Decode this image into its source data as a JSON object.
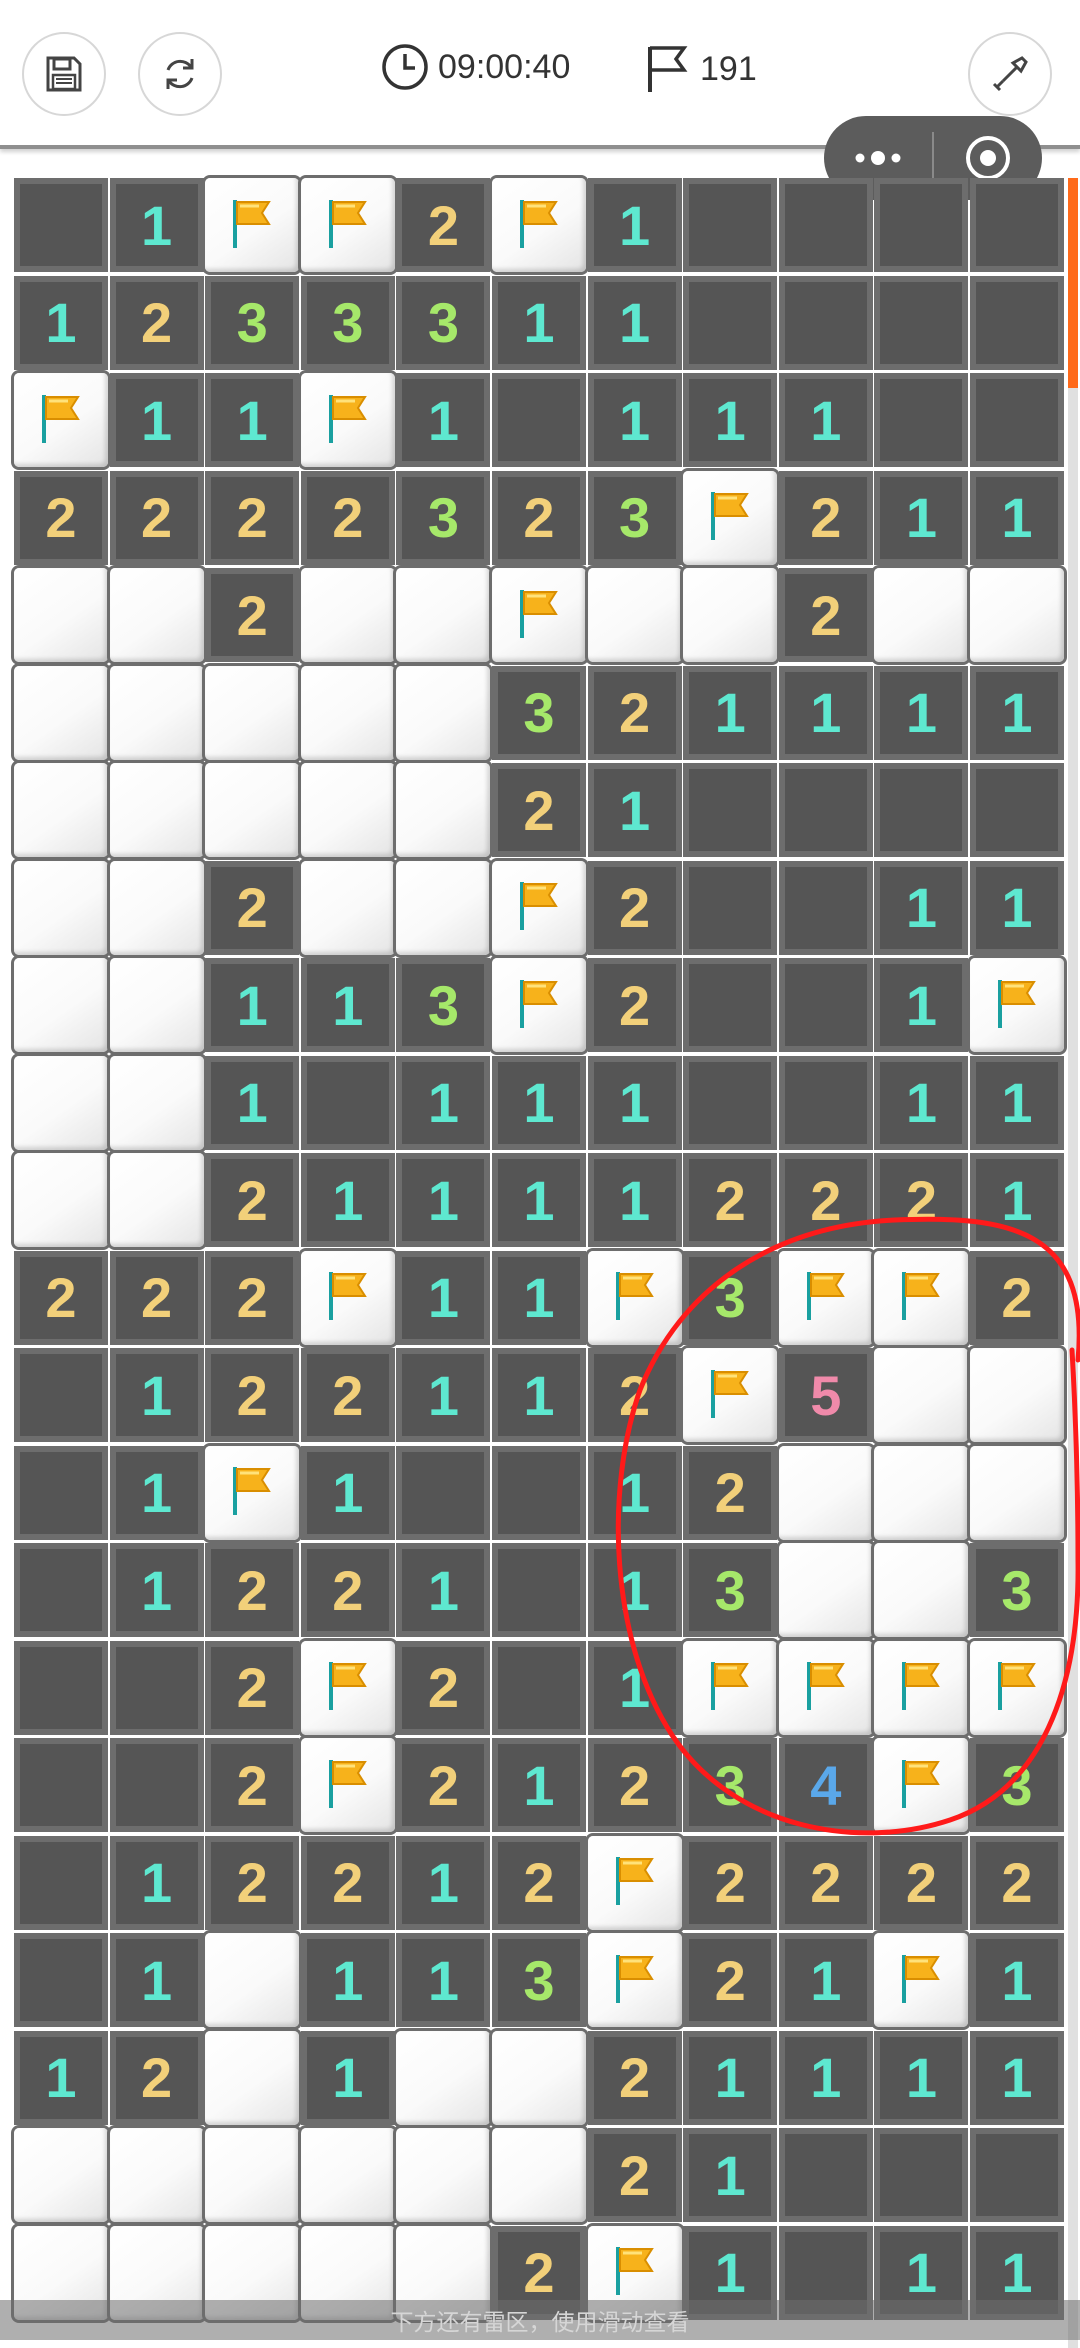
{
  "toolbar": {
    "save_icon": "save-icon",
    "restart_icon": "restart-icon",
    "clock_icon": "clock-icon",
    "timer": "09:00:40",
    "flag_icon": "flag-icon",
    "flag_count": "191",
    "shovel_icon": "shovel-icon"
  },
  "capsule": {
    "more_icon": "more-dots-icon",
    "close_icon": "target-circle-icon"
  },
  "board": {
    "rows": [
      [
        "-",
        "1",
        "F",
        "F",
        "2",
        "F",
        "1",
        "-",
        "-",
        "-",
        "-"
      ],
      [
        "1",
        "2",
        "3",
        "3",
        "3",
        "1",
        "1",
        "-",
        "-",
        "-",
        "-"
      ],
      [
        "F",
        "1",
        "1",
        "F",
        "1",
        "-",
        "1",
        "1",
        "1",
        "-",
        "-"
      ],
      [
        "2",
        "2",
        "2",
        "2",
        "3",
        "2",
        "3",
        "F",
        "2",
        "1",
        "1"
      ],
      [
        "C",
        "C",
        "2",
        "C",
        "C",
        "F",
        "C",
        "C",
        "2",
        "C",
        "C"
      ],
      [
        "C",
        "C",
        "C",
        "C",
        "C",
        "3",
        "2",
        "1",
        "1",
        "1",
        "1"
      ],
      [
        "C",
        "C",
        "C",
        "C",
        "C",
        "2",
        "1",
        "-",
        "-",
        "-",
        "-"
      ],
      [
        "C",
        "C",
        "2",
        "C",
        "C",
        "F",
        "2",
        "-",
        "-",
        "1",
        "1"
      ],
      [
        "C",
        "C",
        "1",
        "1",
        "3",
        "F",
        "2",
        "-",
        "-",
        "1",
        "F"
      ],
      [
        "C",
        "C",
        "1",
        "-",
        "1",
        "1",
        "1",
        "-",
        "-",
        "1",
        "1"
      ],
      [
        "C",
        "C",
        "2",
        "1",
        "1",
        "1",
        "1",
        "2",
        "2",
        "2",
        "1"
      ],
      [
        "2",
        "2",
        "2",
        "F",
        "1",
        "1",
        "F",
        "3",
        "F",
        "F",
        "2"
      ],
      [
        "-",
        "1",
        "2",
        "2",
        "1",
        "1",
        "2",
        "F",
        "5",
        "C",
        "C"
      ],
      [
        "-",
        "1",
        "F",
        "1",
        "-",
        "-",
        "1",
        "2",
        "C",
        "C",
        "C"
      ],
      [
        "-",
        "1",
        "2",
        "2",
        "1",
        "-",
        "1",
        "3",
        "C",
        "C",
        "3"
      ],
      [
        "-",
        "-",
        "2",
        "F",
        "2",
        "-",
        "1",
        "F",
        "F",
        "F",
        "F"
      ],
      [
        "-",
        "-",
        "2",
        "F",
        "2",
        "1",
        "2",
        "3",
        "4",
        "F",
        "3"
      ],
      [
        "-",
        "1",
        "2",
        "2",
        "1",
        "2",
        "F",
        "2",
        "2",
        "2",
        "2"
      ],
      [
        "-",
        "1",
        "C",
        "1",
        "1",
        "3",
        "F",
        "2",
        "1",
        "F",
        "1"
      ],
      [
        "1",
        "2",
        "C",
        "1",
        "C",
        "C",
        "2",
        "1",
        "1",
        "1",
        "1"
      ],
      [
        "C",
        "C",
        "C",
        "C",
        "C",
        "C",
        "2",
        "1",
        "-",
        "-",
        "-"
      ],
      [
        "C",
        "C",
        "C",
        "C",
        "C",
        "2",
        "F",
        "1",
        "-",
        "1",
        "1"
      ]
    ],
    "number_colors": {
      "1": "#5ee8d0",
      "2": "#f2d07a",
      "3": "#a6e86a",
      "4": "#5aa8ea",
      "5": "#f08aaa"
    },
    "flag_color": "#f7b21b",
    "annotation_color": "#ff1a1a"
  },
  "hint_text": "下方还有雷区，使用滑动查看"
}
